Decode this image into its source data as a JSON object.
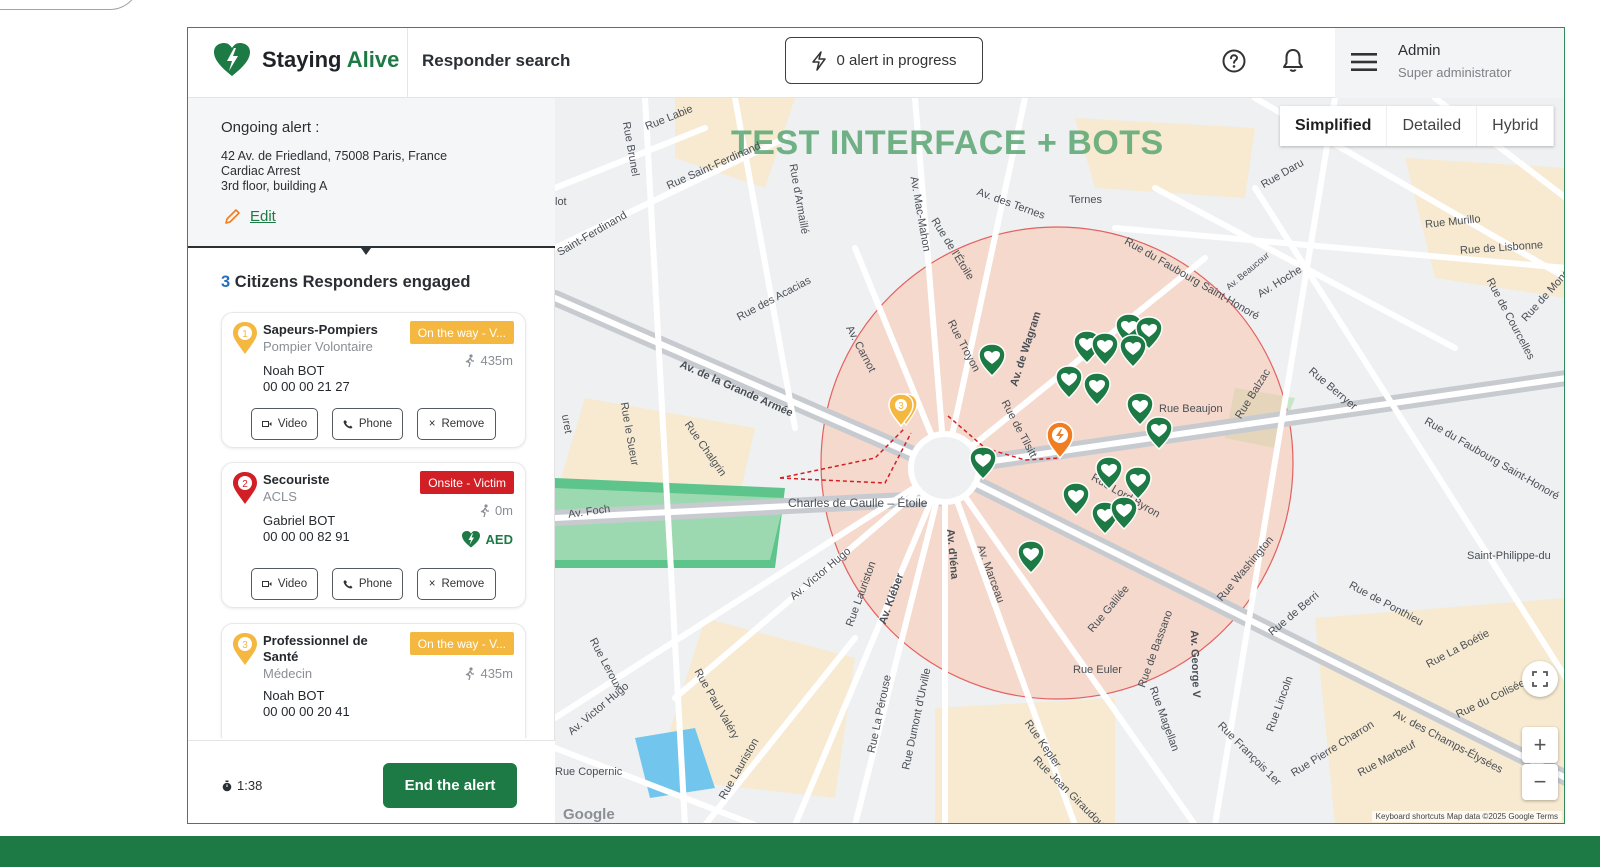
{
  "app": {
    "brand_first": "Staying",
    "brand_second": "Alive",
    "page_title": "Responder search",
    "alert_button": "0 alert in progress",
    "user_name": "Admin",
    "user_role": "Super administrator"
  },
  "alert": {
    "heading": "Ongoing alert :",
    "address": "42 Av. de Friedland, 75008 Paris, France",
    "type": "Cardiac Arrest",
    "location_detail": "3rd floor, building A",
    "edit_label": "Edit"
  },
  "responders": {
    "count": "3",
    "title": "Citizens Responders engaged",
    "items": [
      {
        "number": "1",
        "role": "Sapeurs-Pompiers",
        "subrole": "Pompier Volontaire",
        "status": "On the way - V...",
        "distance": "435m",
        "name": "Noah BOT",
        "phone": "00 00 00 21 27"
      },
      {
        "number": "2",
        "role": "Secouriste",
        "subrole": "ACLS",
        "status": "Onsite - Victim",
        "distance": "0m",
        "name": "Gabriel BOT",
        "phone": "00 00 00 82 91",
        "aed": "AED"
      },
      {
        "number": "3",
        "role": "Professionnel de Santé",
        "subrole": "Médecin",
        "status": "On the way - V...",
        "distance": "435m",
        "name": "Noah BOT",
        "phone": "00 00 00 20 41"
      }
    ],
    "video_label": "Video",
    "phone_label": "Phone",
    "remove_label": "Remove"
  },
  "footer": {
    "timer": "1:38",
    "end_button": "End the alert"
  },
  "map": {
    "overlay_title": "TEST INTERFACE + BOTS",
    "view_options": [
      "Simplified",
      "Detailed",
      "Hybrid"
    ],
    "selected_view": "Simplified",
    "streets": [
      "Rue Labie",
      "Rue Brunel",
      "Rue Saint-Ferdinand",
      "Rue d'Armaillé",
      "Av. des Ternes",
      "Ternes",
      "Rue Daru",
      "Rue Murillo",
      "Rue de Lisbonne",
      "Av. Mac-Mahon",
      "Rue de l'Étoile",
      "Rue du Faubourg Saint-Honoré",
      "Av. Hoche",
      "Av. Beaucour",
      "Rue des Acacias",
      "Av. de la Grande Armée",
      "Av. Carnot",
      "Rue Troyon",
      "Av. de Wagram",
      "Rue Beaujon",
      "Rue Balzac",
      "Rue Berryer",
      "Rue de Courcelles",
      "Rue de Monceau",
      "Rue du Faubourg Saint-Honoré",
      "Rue Chalgrin",
      "Rue le Sueur",
      "Rue de Tilsitt",
      "Av. Foch",
      "Charles de Gaulle – Étoile",
      "Rue Lord Byron",
      "Saint-Philippe-du",
      "Av. Victor Hugo",
      "Rue Lauriston",
      "Av. Kléber",
      "Av. d'Iéna",
      "Av. Marceau",
      "Rue Galilée",
      "Rue Washington",
      "Rue de Berri",
      "Rue de Ponthieu",
      "Rue La Boétie",
      "Rue Euler",
      "Rue de Bassano",
      "Av. George V",
      "Rue Lincoln",
      "Av. des Champs-Élysées",
      "Rue du Colisée",
      "Rue Pierre Charron",
      "Rue Marbeuf",
      "Rue François 1er",
      "Rue Magellan",
      "Rue Kepler",
      "Rue Jean Giraudoux",
      "Rue La Pérouse",
      "Rue Dumont d'Urville",
      "Rue Paul Valéry",
      "Rue Copernic",
      "Rue Leroux",
      "Av. Victor Hugo",
      "Rue Lauriston",
      "Saint-Ferdinand",
      "uret",
      "lot"
    ],
    "keyboard_shortcuts": "Keyboard shortcuts",
    "map_data": "Map data ©2025 Google",
    "terms": "Terms",
    "google": "Google",
    "zoom_in": "+",
    "zoom_out": "−",
    "cluster_label": "3"
  },
  "colors": {
    "brand_green": "#1e7a45",
    "way_status": "#f4b740",
    "onsite_status": "#d21f26",
    "alert_orange": "#f07d22",
    "radius_fill": "#f6cfbe"
  },
  "icons": [
    "heart-logo-icon",
    "bolt-icon",
    "help-icon",
    "bell-icon",
    "menu-icon",
    "pencil-icon",
    "responder-pin-icon",
    "walk-icon",
    "aed-heart-icon",
    "video-icon",
    "phone-icon",
    "close-icon",
    "timer-icon",
    "fullscreen-icon"
  ]
}
